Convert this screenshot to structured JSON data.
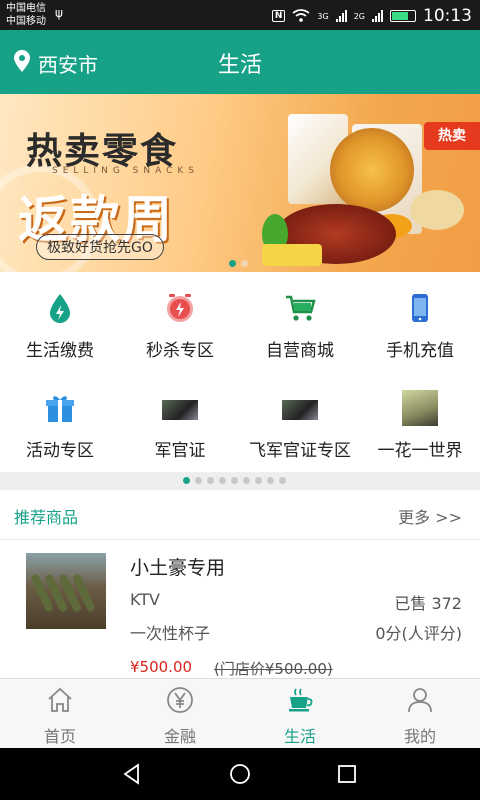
{
  "statusbar": {
    "carrier1": "中国电信",
    "carrier2": "中国移动",
    "net1": "3G",
    "net2": "2G",
    "time": "10:13",
    "battery_level": 0.75
  },
  "header": {
    "city": "西安市",
    "title": "生活"
  },
  "banner": {
    "title": "热卖零食",
    "english": "SELLING SNACKS",
    "big_text": "返款周",
    "subtitle": "极致好货抢先GO",
    "hot_badge": "热卖",
    "page_count": 2,
    "active_page": 0
  },
  "services": [
    {
      "label": "生活缴费",
      "icon": "utility-payment-icon"
    },
    {
      "label": "秒杀专区",
      "icon": "flash-sale-icon"
    },
    {
      "label": "自营商城",
      "icon": "shopping-cart-icon"
    },
    {
      "label": "手机充值",
      "icon": "phone-recharge-icon"
    },
    {
      "label": "活动专区",
      "icon": "gift-icon"
    },
    {
      "label": "军官证",
      "icon": "thumbnail-image"
    },
    {
      "label": "飞军官证专区",
      "icon": "thumbnail-image"
    },
    {
      "label": "一花一世界",
      "icon": "thumbnail-image"
    }
  ],
  "services_pages": {
    "count": 9,
    "active": 0
  },
  "recommend": {
    "title": "推荐商品",
    "more": "更多 >>"
  },
  "product": {
    "name": "小土豪专用",
    "tag1": "KTV",
    "sold": "已售 372",
    "tag2": "一次性杯子",
    "rating": "0分(人评分)",
    "price": "¥500.00",
    "original_price": "(门店价¥500.00)"
  },
  "tabbar": {
    "items": [
      {
        "label": "首页",
        "icon": "home-icon",
        "active": false
      },
      {
        "label": "金融",
        "icon": "yen-icon",
        "active": false
      },
      {
        "label": "生活",
        "icon": "coffee-cup-icon",
        "active": true
      },
      {
        "label": "我的",
        "icon": "user-icon",
        "active": false
      }
    ]
  },
  "colors": {
    "accent": "#17a288",
    "price": "#d9261c"
  }
}
